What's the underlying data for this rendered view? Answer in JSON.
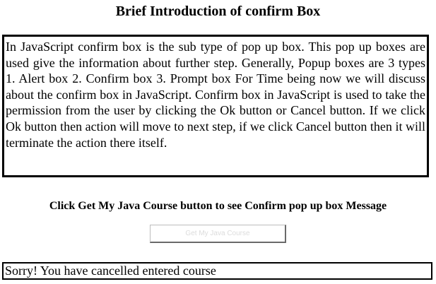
{
  "page": {
    "title": "Brief Introduction of confirm Box"
  },
  "intro": {
    "text": "In JavaScript confirm box is the sub type of pop up box. This pop up boxes are used give the information about further step. Generally, Popup boxes are 3 types 1. Alert box 2. Confirm box 3. Prompt box For Time being now we will discuss about the confirm box in JavaScript. Confirm box in JavaScript is used to take the permission from the user by clicking the Ok button or Cancel button. If we click Ok button then action will move to next step, if we click Cancel button then it will terminate the action there itself."
  },
  "instruction": {
    "text": "Click Get My Java Course button to see Confirm pop up box Message"
  },
  "button": {
    "label": "Get My Java Course"
  },
  "result": {
    "text": "Sorry! You have cancelled entered course"
  }
}
